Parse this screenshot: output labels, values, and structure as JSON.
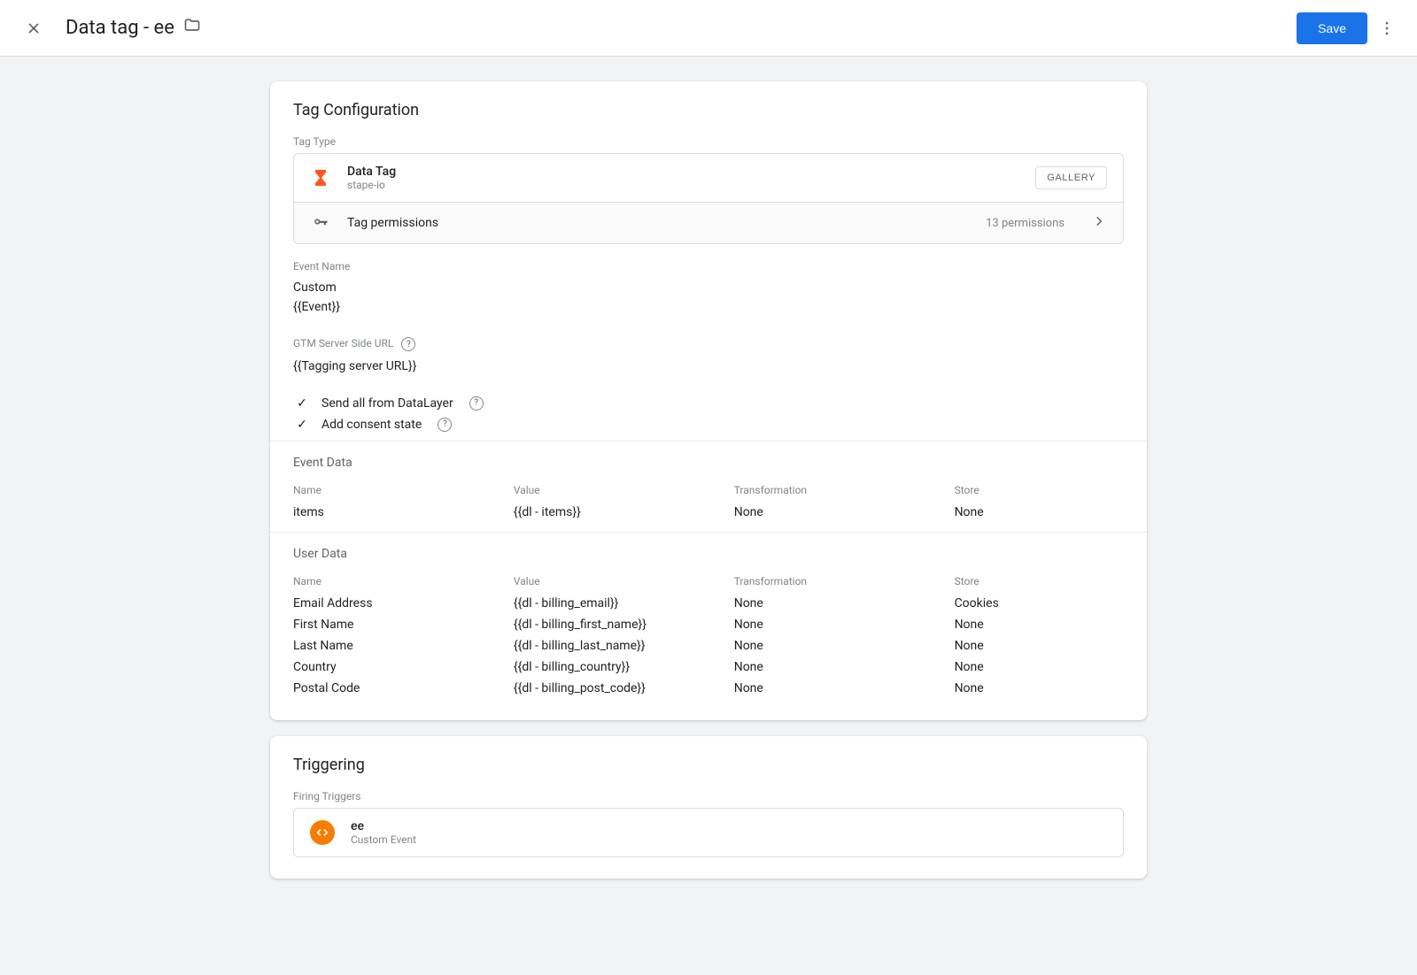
{
  "header": {
    "title": "Data tag - ee",
    "save_label": "Save"
  },
  "tag_config": {
    "heading": "Tag Configuration",
    "tag_type_label": "Tag Type",
    "tag_type": {
      "name": "Data Tag",
      "vendor": "stape-io",
      "gallery_label": "GALLERY"
    },
    "permissions": {
      "label": "Tag permissions",
      "count_text": "13 permissions"
    },
    "event_name": {
      "label": "Event Name",
      "value1": "Custom",
      "value2": "{{Event}}"
    },
    "server_url": {
      "label": "GTM Server Side URL",
      "value": "{{Tagging server URL}}"
    },
    "checks": {
      "send_all": "Send all from DataLayer",
      "consent": "Add consent state"
    },
    "event_data": {
      "heading": "Event Data",
      "columns": [
        "Name",
        "Value",
        "Transformation",
        "Store"
      ],
      "rows": [
        {
          "name": "items",
          "value": "{{dl - items}}",
          "transformation": "None",
          "store": "None"
        }
      ]
    },
    "user_data": {
      "heading": "User Data",
      "columns": [
        "Name",
        "Value",
        "Transformation",
        "Store"
      ],
      "rows": [
        {
          "name": "Email Address",
          "value": "{{dl - billing_email}}",
          "transformation": "None",
          "store": "Cookies"
        },
        {
          "name": "First Name",
          "value": "{{dl - billing_first_name}}",
          "transformation": "None",
          "store": "None"
        },
        {
          "name": "Last Name",
          "value": "{{dl - billing_last_name}}",
          "transformation": "None",
          "store": "None"
        },
        {
          "name": "Country",
          "value": "{{dl - billing_country}}",
          "transformation": "None",
          "store": "None"
        },
        {
          "name": "Postal Code",
          "value": "{{dl - billing_post_code}}",
          "transformation": "None",
          "store": "None"
        }
      ]
    }
  },
  "triggering": {
    "heading": "Triggering",
    "firing_label": "Firing Triggers",
    "trigger": {
      "name": "ee",
      "type": "Custom Event"
    }
  }
}
